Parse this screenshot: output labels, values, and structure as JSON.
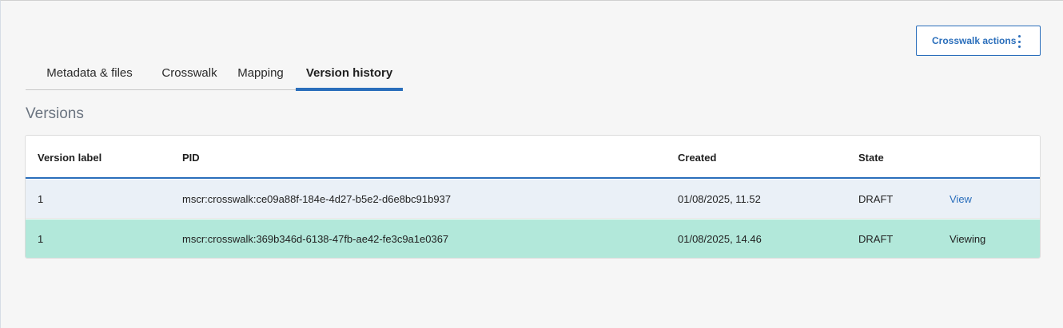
{
  "header": {
    "actions_label": "Crosswalk actions"
  },
  "tabs": [
    {
      "label": "Metadata & files"
    },
    {
      "label": "Crosswalk"
    },
    {
      "label": "Mapping"
    },
    {
      "label": "Version history"
    }
  ],
  "section": {
    "title": "Versions"
  },
  "table": {
    "columns": [
      "Version label",
      "PID",
      "Created",
      "State",
      ""
    ],
    "rows": [
      {
        "version_label": "1",
        "pid": "mscr:crosswalk:ce09a88f-184e-4d27-b5e2-d6e8bc91b937",
        "created": "01/08/2025, 11.52",
        "state": "DRAFT",
        "action": "View"
      },
      {
        "version_label": "1",
        "pid": "mscr:crosswalk:369b346d-6138-47fb-ae42-fe3c9a1e0367",
        "created": "01/08/2025, 14.46",
        "state": "DRAFT",
        "action": "Viewing"
      }
    ]
  },
  "colors": {
    "accent": "#2a6ebb",
    "row_selected": "#b2e8da",
    "row_alt": "#eaf0f7"
  },
  "icons": {
    "actions_menu": "kebab-vertical-icon"
  }
}
